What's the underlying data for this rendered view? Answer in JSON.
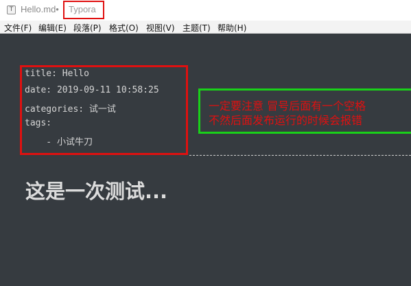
{
  "window": {
    "doc_title": "Hello.md•",
    "app_name": "Typora",
    "app_icon_glyph": "T"
  },
  "menubar": {
    "items": [
      "文件(F)",
      "编辑(E)",
      "段落(P)",
      "格式(O)",
      "视图(V)",
      "主题(T)",
      "帮助(H)"
    ]
  },
  "front_matter": {
    "title_line": "title: Hello",
    "date_line": "date: 2019-09-11 10:58:25",
    "categories_line": "categories: 试一试",
    "tags_line": "tags:",
    "tag_item_line": "    - 小试牛刀"
  },
  "note": {
    "line1": "一定要注意 冒号后面有一个空格",
    "line2": "不然后面发布运行的时候会报错"
  },
  "content": {
    "heading": "这是一次测试..."
  },
  "colors": {
    "editor_bg": "#363B40",
    "annotation_red": "#e01010",
    "annotation_green": "#19d119"
  }
}
